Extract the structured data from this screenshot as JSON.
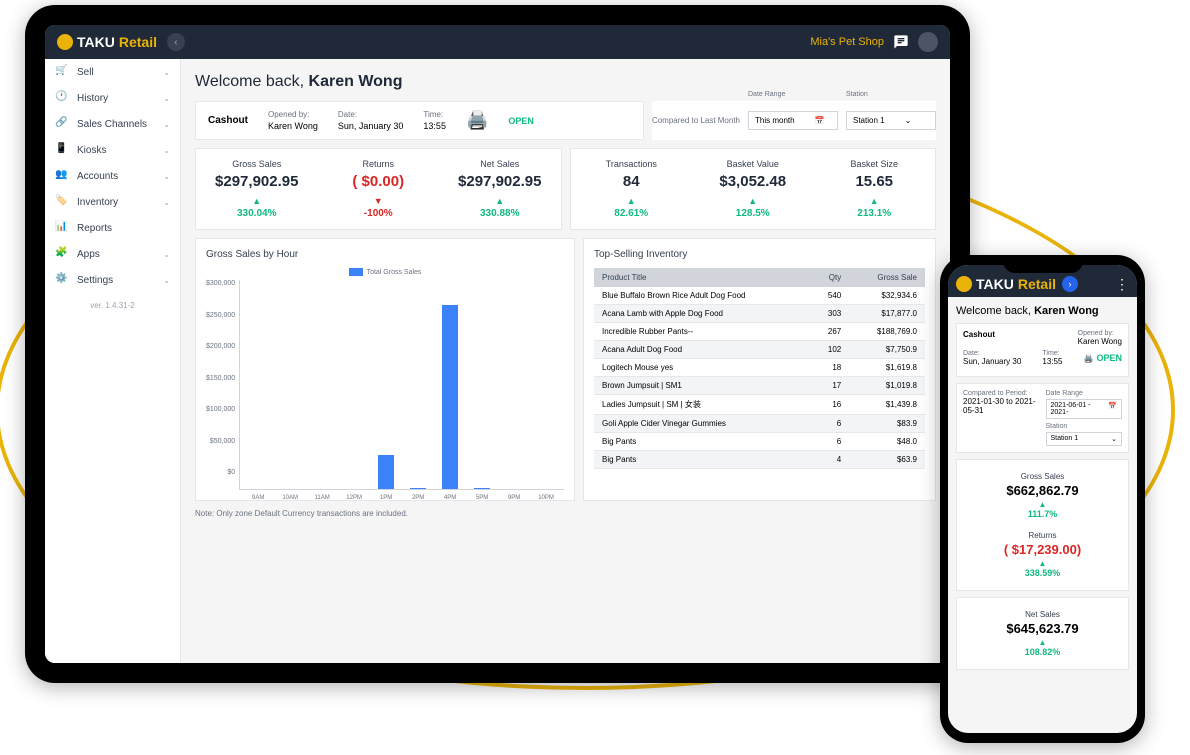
{
  "brand": {
    "text1": "TAKU",
    "text2": "Retail"
  },
  "topbar": {
    "shop_name": "Mia's Pet Shop"
  },
  "sidebar": {
    "items": [
      {
        "label": "Sell",
        "icon": "cart"
      },
      {
        "label": "History",
        "icon": "history"
      },
      {
        "label": "Sales Channels",
        "icon": "channels"
      },
      {
        "label": "Kiosks",
        "icon": "kiosk"
      },
      {
        "label": "Accounts",
        "icon": "accounts"
      },
      {
        "label": "Inventory",
        "icon": "tag"
      },
      {
        "label": "Reports",
        "icon": "chart"
      },
      {
        "label": "Apps",
        "icon": "apps"
      },
      {
        "label": "Settings",
        "icon": "gear"
      }
    ],
    "version": "ver. 1.4.31-2"
  },
  "welcome": {
    "prefix": "Welcome back, ",
    "name": "Karen Wong"
  },
  "cashout": {
    "title": "Cashout",
    "opened_by_label": "Opened by:",
    "opened_by": "Karen Wong",
    "date_label": "Date:",
    "date": "Sun, January 30",
    "time_label": "Time:",
    "time": "13:55",
    "status": "OPEN"
  },
  "filters": {
    "compare_label": "Compared to Last Month",
    "date_range_label": "Date Range",
    "date_range": "This month",
    "station_label": "Station",
    "station": "Station 1"
  },
  "stats_left": [
    {
      "label": "Gross Sales",
      "value": "$297,902.95",
      "dir": "up",
      "change": "330.04%",
      "color": "green"
    },
    {
      "label": "Returns",
      "value": "( $0.00)",
      "dir": "down",
      "change": "-100%",
      "color": "red",
      "value_color": "red"
    },
    {
      "label": "Net Sales",
      "value": "$297,902.95",
      "dir": "up",
      "change": "330.88%",
      "color": "green"
    }
  ],
  "stats_right": [
    {
      "label": "Transactions",
      "value": "84",
      "dir": "up",
      "change": "82.61%",
      "color": "green"
    },
    {
      "label": "Basket Value",
      "value": "$3,052.48",
      "dir": "up",
      "change": "128.5%",
      "color": "green"
    },
    {
      "label": "Basket Size",
      "value": "15.65",
      "dir": "up",
      "change": "213.1%",
      "color": "green"
    }
  ],
  "chart_panel": {
    "title": "Gross Sales by Hour",
    "legend": "Total Gross Sales"
  },
  "chart_data": {
    "type": "bar",
    "title": "Gross Sales by Hour",
    "categories": [
      "9AM",
      "10AM",
      "11AM",
      "12PM",
      "1PM",
      "2PM",
      "4PM",
      "5PM",
      "9PM",
      "10PM"
    ],
    "series": [
      {
        "name": "Total Gross Sales",
        "values": [
          0,
          0,
          0,
          0,
          52000,
          2000,
          282000,
          2000,
          0,
          0
        ]
      }
    ],
    "ylabel": "",
    "xlabel": "",
    "y_ticks": [
      "$300,000",
      "$250,000",
      "$200,000",
      "$150,000",
      "$100,000",
      "$50,000",
      "$0"
    ],
    "ylim": [
      0,
      300000
    ]
  },
  "table_panel": {
    "title": "Top-Selling Inventory",
    "headers": [
      "Product Title",
      "Qty",
      "Gross Sale"
    ],
    "rows": [
      [
        "Blue Buffalo Brown Rice Adult Dog Food",
        "540",
        "$32,934.6"
      ],
      [
        "Acana Lamb with Apple Dog Food",
        "303",
        "$17,877.0"
      ],
      [
        "Incredible Rubber Pants--",
        "267",
        "$188,769.0"
      ],
      [
        "Acana Adult Dog Food",
        "102",
        "$7,750.9"
      ],
      [
        "Logitech Mouse yes",
        "18",
        "$1,619.8"
      ],
      [
        "Brown Jumpsuit | SM1",
        "17",
        "$1,019.8"
      ],
      [
        "Ladies Jumpsuit | SM | 女装",
        "16",
        "$1,439.8"
      ],
      [
        "Goli Apple Cider Vinegar Gummies",
        "6",
        "$83.9"
      ],
      [
        "Big Pants",
        "6",
        "$48.0"
      ],
      [
        "Big Pants",
        "4",
        "$63.9"
      ]
    ]
  },
  "note": "Note: Only zone Default Currency transactions are included.",
  "phone": {
    "welcome_prefix": "Welcome back, ",
    "welcome_name": "Karen Wong",
    "cashout": {
      "title": "Cashout",
      "opened_by_label": "Opened by:",
      "opened_by": "Karen Wong",
      "date_label": "Date:",
      "date": "Sun, January 30",
      "time_label": "Time:",
      "time": "13:55",
      "status": "OPEN"
    },
    "filters": {
      "compare_label": "Compared to Period:",
      "compare_range": "2021-01-30 to 2021-05-31",
      "date_range_label": "Date Range",
      "date_range": "2021-06-01 - 2021-",
      "station_label": "Station",
      "station": "Station 1"
    },
    "stats": [
      {
        "label": "Gross Sales",
        "value": "$662,862.79",
        "change": "111.7%"
      },
      {
        "label": "Returns",
        "value": "( $17,239.00)",
        "change": "338.59%",
        "value_color": "red"
      },
      {
        "label": "Net Sales",
        "value": "$645,623.79",
        "change": "108.82%"
      }
    ]
  }
}
